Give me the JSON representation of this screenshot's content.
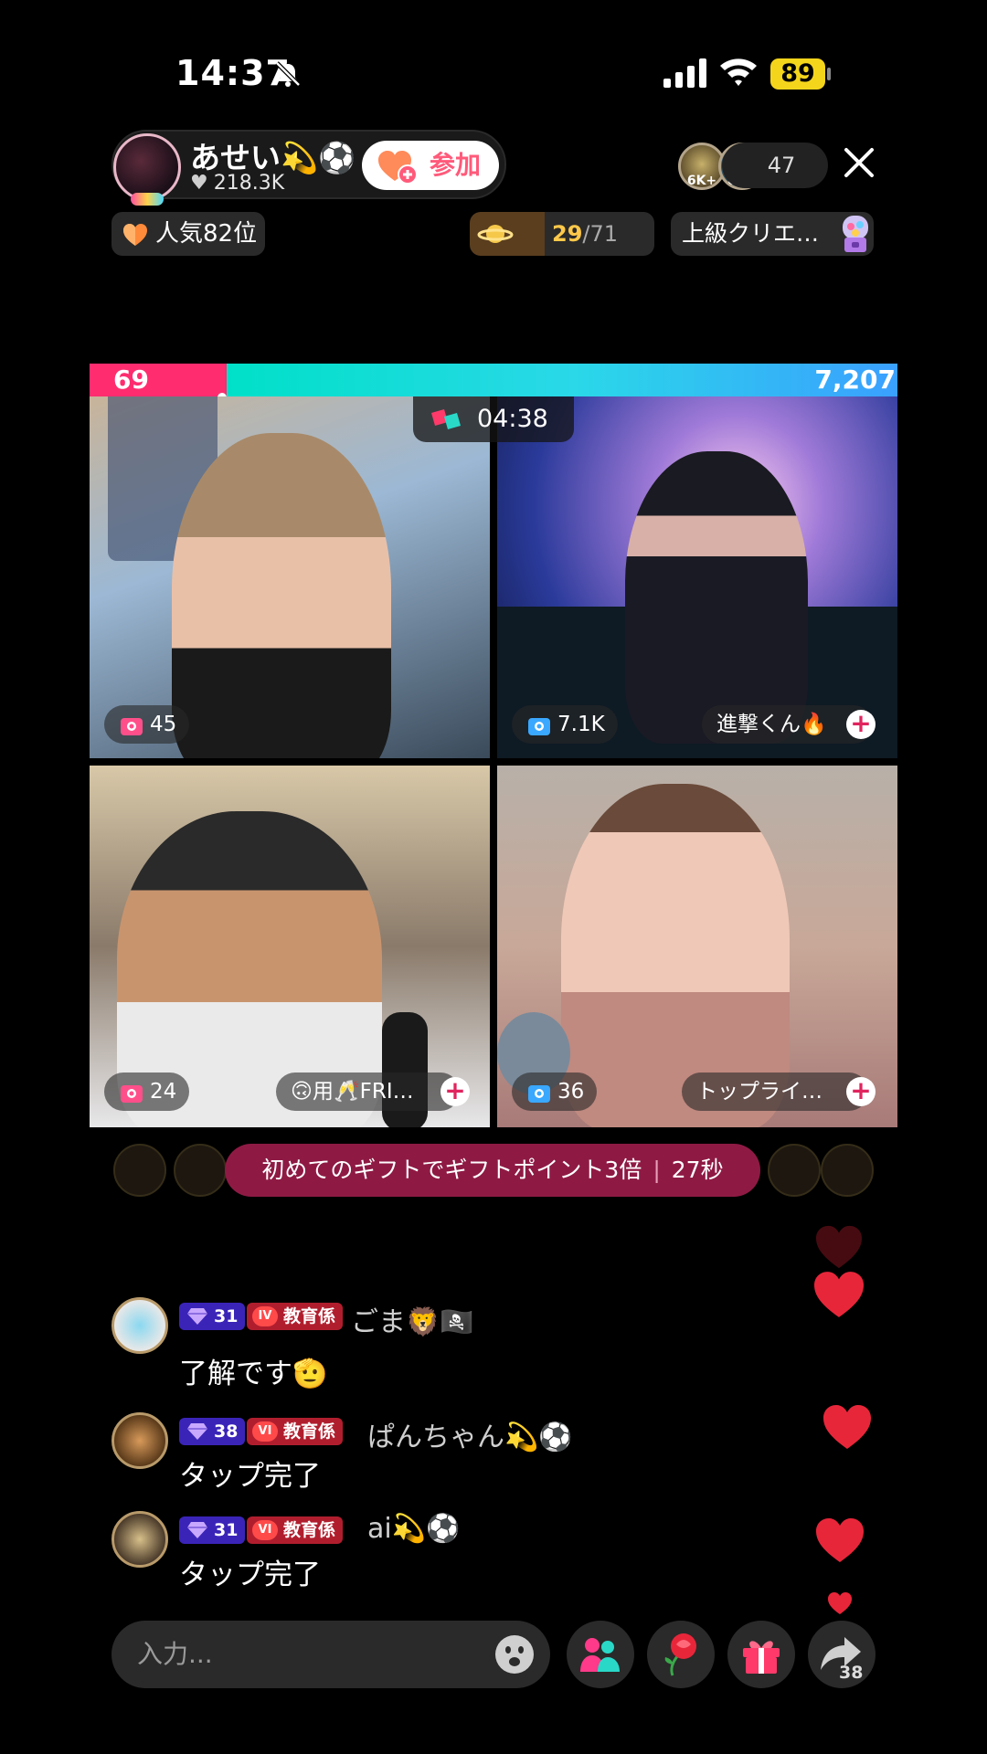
{
  "status_bar": {
    "time": "14:37",
    "battery": "89"
  },
  "host": {
    "name": "あせい💫⚽",
    "likes": "218.3K",
    "join_label": "参加"
  },
  "viewers": {
    "avatar_labels": [
      "6K+",
      "6K+"
    ],
    "count": "47"
  },
  "badges": {
    "rank": "人気82位",
    "goal_current": "29",
    "goal_total": "/71",
    "creator": "上級クリエ…"
  },
  "battle": {
    "left_score": "69",
    "right_score": "7,207",
    "timer": "04:38"
  },
  "tiles": [
    {
      "score": "45",
      "name": "",
      "icon_color": "#ff4f8a"
    },
    {
      "score": "7.1K",
      "name": "進撃くん🔥",
      "icon_color": "#3aa8ff"
    },
    {
      "score": "24",
      "name": "🙃用🥂FRI…",
      "icon_color": "#ff4f8a"
    },
    {
      "score": "36",
      "name": "トップライ…",
      "icon_color": "#3aa8ff"
    }
  ],
  "promo": {
    "text": "初めてのギフトでギフトポイント3倍",
    "countdown": "27秒"
  },
  "comments": [
    {
      "level": "31",
      "role_tag": "IV",
      "role": "教育係",
      "user": "ごま🦁🏴‍☠️",
      "text": "了解です🫡"
    },
    {
      "level": "38",
      "role_tag": "VI",
      "role": "教育係",
      "user": "ぱんちゃん💫⚽",
      "text": "タップ完了"
    },
    {
      "level": "31",
      "role_tag": "VI",
      "role": "教育係",
      "user": "ai💫⚽",
      "text": "タップ完了"
    }
  ],
  "bottom_bar": {
    "input_placeholder": "入力...",
    "share_count": "38"
  },
  "icons": [
    "mute-icon",
    "signal-icon",
    "wifi-icon",
    "heart-plus-icon",
    "close-icon",
    "heart-icon",
    "planet-icon",
    "gacha-icon",
    "versus-icon",
    "gift-box-icon",
    "plus-icon",
    "gem-icon",
    "emoji-icon",
    "guests-icon",
    "rose-icon",
    "gift-icon",
    "share-icon"
  ],
  "colors": {
    "accent_pink": "#ff2d6f",
    "accent_cyan": "#00e0c8",
    "promo_bg": "#8e1a44",
    "heart_red": "#e8263a",
    "level_badge": "#3a24b8",
    "role_badge": "#b01e2e"
  }
}
